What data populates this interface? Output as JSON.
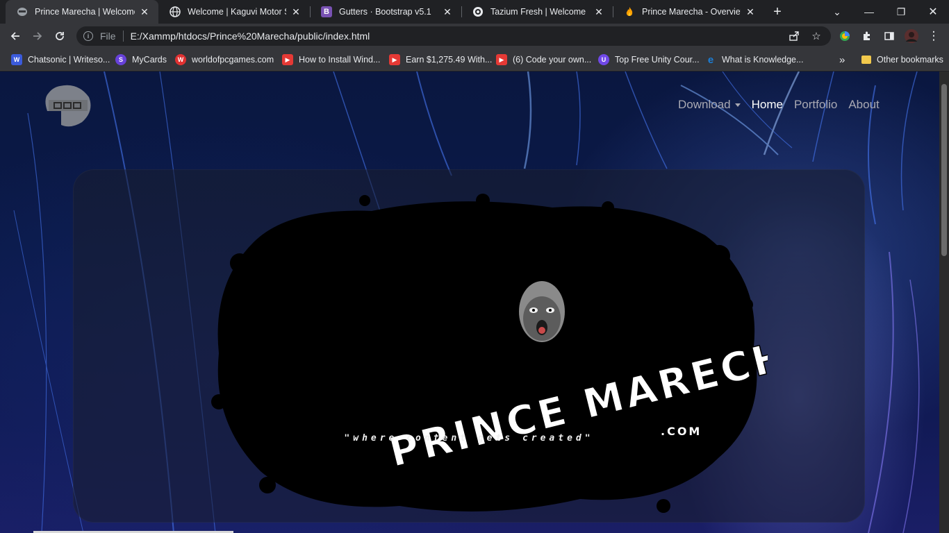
{
  "tabs": [
    {
      "title": "Prince Marecha | Welcome",
      "icon": "site-favicon",
      "active": true
    },
    {
      "title": "Welcome | Kaguvi Motor Spa",
      "icon": "globe-icon",
      "active": false
    },
    {
      "title": "Gutters · Bootstrap v5.1",
      "icon": "bootstrap-icon",
      "active": false
    },
    {
      "title": "Tazium Fresh | Welcome",
      "icon": "circle-icon",
      "active": false
    },
    {
      "title": "Prince Marecha - Overview -",
      "icon": "fire-icon",
      "active": false
    }
  ],
  "toolbar": {
    "scheme": "File",
    "url": "E:/Xammp/htdocs/Prince%20Marecha/public/index.html"
  },
  "bookmarks": {
    "items": [
      {
        "label": "Chatsonic | Writeso...",
        "icon": "W",
        "color": "#3b5bdb"
      },
      {
        "label": "MyCards",
        "icon": "S",
        "color": "#6741d9"
      },
      {
        "label": "worldofpcgames.com",
        "icon": "W",
        "color": "#e03131"
      },
      {
        "label": "How to Install Wind...",
        "icon": "▶",
        "color": "#e53935"
      },
      {
        "label": "Earn $1,275.49 With...",
        "icon": "▶",
        "color": "#e53935"
      },
      {
        "label": "(6) Code your own...",
        "icon": "▶",
        "color": "#e53935"
      },
      {
        "label": "Top Free Unity Cour...",
        "icon": "U",
        "color": "#7048e8"
      },
      {
        "label": "What is Knowledge...",
        "icon": "e",
        "color": "#1c7ed6"
      }
    ],
    "more": "»",
    "other": "Other bookmarks"
  },
  "site": {
    "nav": {
      "download": "Download",
      "home": "Home",
      "portfolio": "Portfolio",
      "about": "About"
    },
    "logo_text": "PRINCE MARECHA",
    "logo_suffix": ".COM",
    "tagline": "\"where content gets created\""
  }
}
